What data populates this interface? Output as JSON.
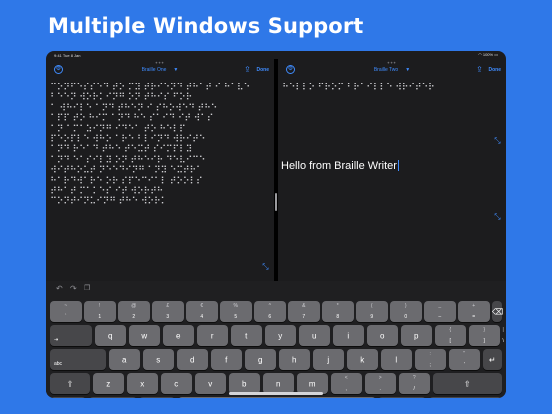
{
  "headline": "Multiple Windows Support",
  "status": {
    "time": "9:41",
    "date": "Tue 8 Jan",
    "battery": "100%",
    "signal": "wifi"
  },
  "left_pane": {
    "title": "Braille One",
    "done": "Done",
    "braille_lines": [
      "⠉⠕⠝⠋⠑⠎⠎⠑⠙ ⠞⠕ ⠍⠽ ⠞⠗⠊⠑⠝⠙ ⠞⠓⠁⠞ ⠊ ⠓⠁⠧⠑",
      "⠃⠑⠑⠝ ⠺⠕⠗⠅⠊⠝⠛ ⠕⠝ ⠞⠓⠊⠎ ⠋⠕⠗",
      "⠁ ⠺⠓⠊⠇⠑ ⠁⠝⠙ ⠞⠓⠑⠝ ⠊ ⠎⠓⠕⠺⠑⠙ ⠞⠓⠑",
      "⠁⠏⠏ ⠞⠕ ⠓⠊⠍ ⠁⠝⠙ ⠓⠑ ⠎⠁⠊⠙ ⠊⠞ ⠺⠁⠎",
      "⠁⠝ ⠁⠍⠁⠵⠊⠝⠛ ⠊⠙⠑⠁ ⠞⠕ ⠓⠑⠇⠏",
      "⠏⠑⠕⠏⠇⠑ ⠺⠓⠕ ⠁⠗⠑ ⠃⠇⠊⠝⠙ ⠺⠗⠊⠞⠑",
      "⠁⠝⠙ ⠗⠑⠁⠙ ⠞⠓⠑ ⠞⠑⠭⠞ ⠎⠊⠍⠏⠇⠽",
      "⠁⠝⠙ ⠑⠁⠎⠊⠇⠽ ⠕⠝ ⠞⠓⠑⠊⠗ ⠙⠑⠧⠊⠉⠑",
      "⠺⠊⠞⠓⠕⠥⠞ ⠝⠑⠑⠙⠊⠝⠛ ⠁⠝⠽ ⠑⠭⠞⠗⠁",
      "⠓⠁⠗⠙⠺⠁⠗⠑ ⠕⠗ ⠎⠏⠑⠉⠊⠁⠇ ⠞⠕⠕⠇⠎",
      "⠞⠓⠁⠞ ⠍⠁⠅⠑⠎ ⠊⠞ ⠺⠕⠗⠞⠓",
      "⠉⠕⠝⠞⠊⠝⠥⠊⠝⠛ ⠞⠓⠑ ⠺⠕⠗⠅"
    ]
  },
  "right_pane": {
    "title": "Braille Two",
    "done": "Done",
    "braille_lines": [
      "⠓⠑⠇⠇⠕ ⠋⠗⠕⠍ ⠃⠗⠁⠊⠇⠇⠑ ⠺⠗⠊⠞⠑⠗"
    ],
    "text": "Hello from Braille Writer"
  },
  "shortcut_bar": {
    "undo": "↶",
    "redo": "↷",
    "paste": "📋"
  },
  "keyboard": {
    "row1": [
      {
        "top": "~",
        "bot": "`"
      },
      {
        "top": "!",
        "bot": "1"
      },
      {
        "top": "@",
        "bot": "2"
      },
      {
        "top": "£",
        "bot": "3"
      },
      {
        "top": "€",
        "bot": "4"
      },
      {
        "top": "%",
        "bot": "5"
      },
      {
        "top": "^",
        "bot": "6"
      },
      {
        "top": "&",
        "bot": "7"
      },
      {
        "top": "*",
        "bot": "8"
      },
      {
        "top": "(",
        "bot": "9"
      },
      {
        "top": ")",
        "bot": "0"
      },
      {
        "top": "_",
        "bot": "–"
      },
      {
        "top": "+",
        "bot": "="
      }
    ],
    "row2": [
      "q",
      "w",
      "e",
      "r",
      "t",
      "y",
      "u",
      "i",
      "o",
      "p"
    ],
    "row2_extra": [
      {
        "top": "{",
        "bot": "["
      },
      {
        "top": "}",
        "bot": "]"
      },
      {
        "top": "|",
        "bot": "\\"
      }
    ],
    "row3": [
      "a",
      "s",
      "d",
      "f",
      "g",
      "h",
      "j",
      "k",
      "l"
    ],
    "row3_extra": [
      {
        "top": ":",
        "bot": ";"
      },
      {
        "top": "\"",
        "bot": "'"
      }
    ],
    "row4": [
      "z",
      "x",
      "c",
      "v",
      "b",
      "n",
      "m"
    ],
    "row4_extra": [
      {
        "top": "<",
        "bot": ","
      },
      {
        "top": ">",
        "bot": "."
      },
      {
        "top": "?",
        "bot": "/"
      }
    ],
    "tab_label": "⇥",
    "caps_label": "abc",
    "shift_icon": "⇧",
    "delete_icon": "⌫",
    "return_icon": "↵",
    "emoji_icon": "☻",
    "numbers_label": ".?123",
    "mic_icon": "🎤",
    "hide_icon": "⌨"
  }
}
